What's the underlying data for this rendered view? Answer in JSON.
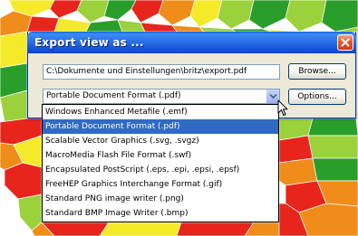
{
  "dialog": {
    "title": "Export view as ...",
    "close_icon": "close-icon",
    "path_value": "C:\\Dokumente und Einstellungen\\britz\\export.pdf",
    "browse_label": "Browse...",
    "options_label": "Options...",
    "format_selected": "Portable Document Format (.pdf)",
    "dropdown_icon": "chevron-down-icon"
  },
  "format_options": [
    "Windows Enhanced Metafile (.emf)",
    "Portable Document Format (.pdf)",
    "Scalable Vector Graphics (.svg, .svgz)",
    "MacroMedia Flash File Format (.swf)",
    "Encapsulated PostScript (.eps, .epi, .epsi, .epsf)",
    "FreeHEP Graphics Interchange Format (.gif)",
    "Standard PNG image writer (.png)",
    "Standard BMP Image Writer (.bmp)"
  ],
  "highlighted_option_index": 1,
  "colors": {
    "titlebar": "#0a5fe8",
    "dialog_face": "#ece9d8",
    "selection": "#316ac5",
    "map_red": "#e8251c",
    "map_orange": "#f08c1a",
    "map_yellow": "#f5ea2a",
    "map_lightgreen": "#9bd23c",
    "map_green": "#2a9e2a"
  },
  "cursor_icon": "arrow-cursor-icon"
}
